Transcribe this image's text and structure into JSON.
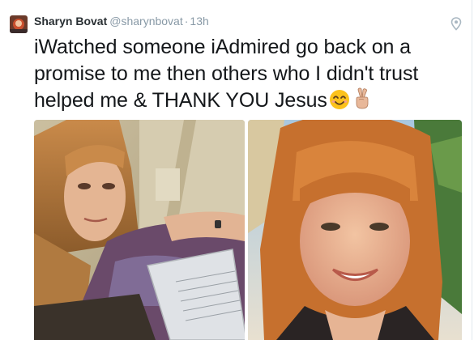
{
  "tweet": {
    "author_name": "Sharyn Bovat",
    "author_handle": "@sharynbovat",
    "separator": "·",
    "timestamp": "13h",
    "text": "iWatched someone iAdmired go back on a promise to me then others who I didn't trust helped me & THANK YOU Jesus",
    "emojis": [
      "smiling-face-emoji",
      "victory-hand-emoji"
    ]
  },
  "icons": {
    "location": "location-pin-icon",
    "avatar": "profile-avatar"
  },
  "media": [
    {
      "name": "selfie-photo-1"
    },
    {
      "name": "selfie-photo-2"
    }
  ],
  "colors": {
    "text": "#14171a",
    "name": "#292f33",
    "muted": "#8899a6",
    "divider": "#e1e8ed"
  }
}
